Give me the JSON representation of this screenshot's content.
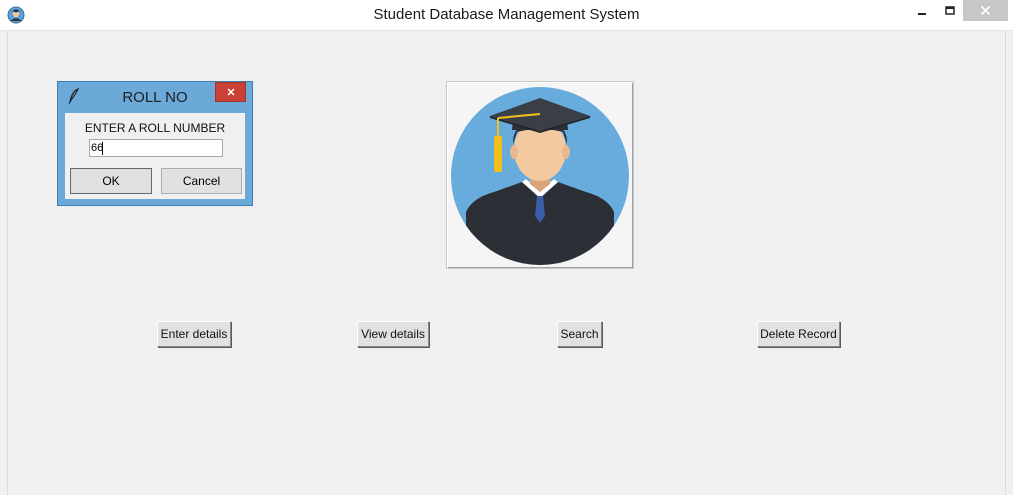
{
  "window": {
    "title": "Student Database Management System"
  },
  "dialog": {
    "title": "ROLL NO",
    "prompt": "ENTER A ROLL NUMBER",
    "input_value": "66",
    "ok_label": "OK",
    "cancel_label": "Cancel"
  },
  "actions": {
    "enter_details": "Enter details",
    "view_details": "View details",
    "search": "Search",
    "delete_record": "Delete Record"
  },
  "icons": {
    "app": "student-avatar-icon",
    "dialog": "feather-icon",
    "photo": "graduate-avatar-image"
  },
  "colors": {
    "window_bg": "#f0f0f0",
    "dialog_frame": "#6baad8",
    "dialog_close": "#c94235",
    "avatar_circle": "#67acdd",
    "gown": "#2c3036",
    "tassel": "#f2c019"
  }
}
